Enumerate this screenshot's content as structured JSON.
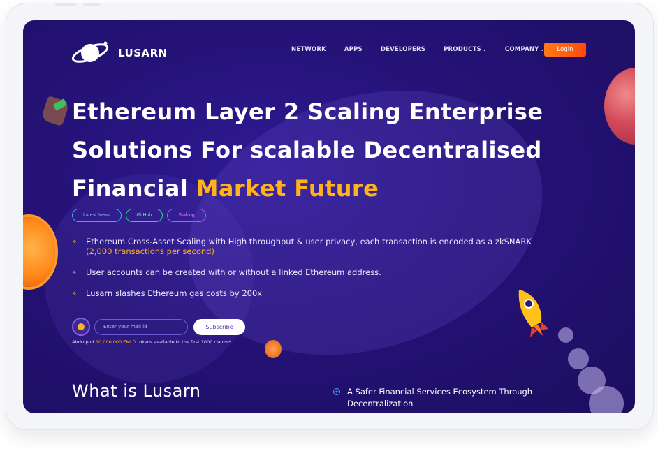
{
  "brand": {
    "name": "LUSARN"
  },
  "nav": {
    "items": [
      {
        "label": "NETWORK",
        "has_dropdown": false
      },
      {
        "label": "APPS",
        "has_dropdown": false
      },
      {
        "label": "DEVELOPERS",
        "has_dropdown": false
      },
      {
        "label": "PRODUCTS",
        "has_dropdown": true
      },
      {
        "label": "COMPANY",
        "has_dropdown": true
      }
    ],
    "login_label": "Login"
  },
  "hero": {
    "title_part1": "Ethereum Layer 2 Scaling Enterprise",
    "title_part2": "Solutions For scalable Decentralised",
    "title_part3": "Financial ",
    "title_highlight": "Market Future",
    "tags": [
      {
        "label": "Latest News"
      },
      {
        "label": "GitHub"
      },
      {
        "label": "Staking"
      }
    ],
    "bullets": {
      "b1_text": "Ethereum Cross-Asset Scaling with High throughput & user privacy, each transaction is encoded as a zkSNARK ",
      "b1_highlight": "(2,000 transactions per second)",
      "b2_text": "User accounts can be created with or without a linked Ethereum address.",
      "b3_text": "Lusarn slashes Ethereum gas costs by 200x"
    },
    "bullet_mark": "»"
  },
  "subscribe": {
    "email_placeholder": "Enter your mail id",
    "button_label": "Subscribe",
    "airdrop_prefix": "Airdrop of ",
    "airdrop_highlight": "10,000,000 EMLD",
    "airdrop_suffix": " tokens available to the first 1000 claims*"
  },
  "about": {
    "title": "What is Lusarn",
    "ecosystem_text": "A Safer Financial Services Ecosystem Through Decentralization"
  },
  "colors": {
    "background": "#241276",
    "accent": "#ffb21a",
    "login": "#ff5a10"
  }
}
